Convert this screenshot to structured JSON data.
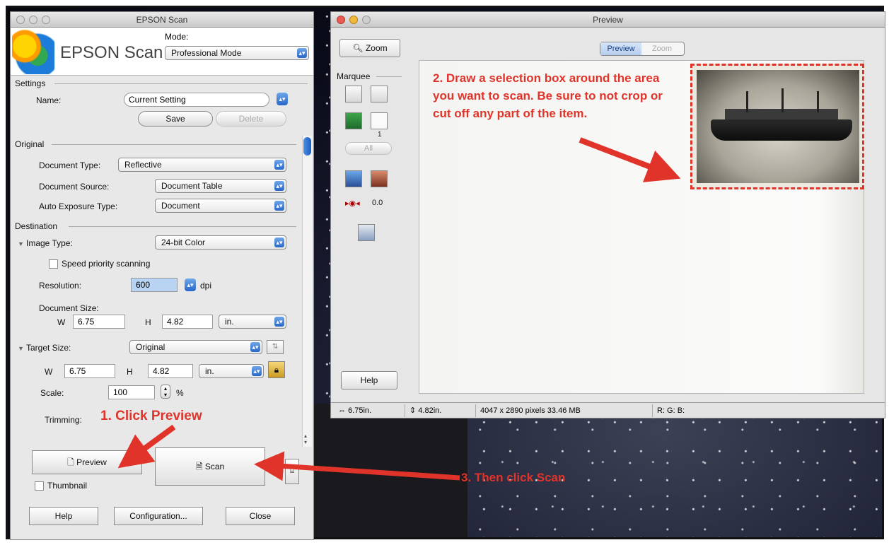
{
  "epson": {
    "title": "EPSON Scan",
    "brand": "EPSON Scan",
    "mode_label": "Mode:",
    "mode_value": "Professional Mode",
    "settings": {
      "heading": "Settings",
      "name_label": "Name:",
      "name_value": "Current Setting",
      "save": "Save",
      "delete": "Delete"
    },
    "original": {
      "heading": "Original",
      "doc_type_label": "Document Type:",
      "doc_type_value": "Reflective",
      "doc_source_label": "Document Source:",
      "doc_source_value": "Document Table",
      "auto_exp_label": "Auto Exposure Type:",
      "auto_exp_value": "Document"
    },
    "destination": {
      "heading": "Destination",
      "image_type_label": "Image Type:",
      "image_type_value": "24-bit Color",
      "speed_label": "Speed priority scanning",
      "resolution_label": "Resolution:",
      "resolution_value": "600",
      "dpi": "dpi",
      "doc_size_label": "Document Size:",
      "w_label": "W",
      "w_value": "6.75",
      "h_label": "H",
      "h_value": "4.82",
      "unit": "in."
    },
    "target": {
      "label": "Target Size:",
      "value": "Original",
      "w_label": "W",
      "w_value": "6.75",
      "h_label": "H",
      "h_value": "4.82",
      "unit": "in.",
      "scale_label": "Scale:",
      "scale_value": "100",
      "percent": "%",
      "trimming_label": "Trimming:"
    },
    "preview_button": "Preview",
    "scan_button": "Scan",
    "thumbnail_label": "Thumbnail",
    "help": "Help",
    "configuration": "Configuration...",
    "close": "Close"
  },
  "preview": {
    "title": "Preview",
    "zoom_button": "Zoom",
    "tabs": [
      "Preview",
      "Zoom"
    ],
    "marquee_label": "Marquee",
    "marquee_count": "1",
    "all_button": "All",
    "exposure_value": "0.0",
    "help": "Help",
    "status": {
      "width": "6.75in.",
      "height": "4.82in.",
      "pixels": "4047 x 2890 pixels 33.46 MB",
      "rgb": "R: G: B:"
    }
  },
  "annotations": {
    "step1": "1. Click Preview",
    "step2": "2. Draw a selection box around the area you want to scan. Be sure to not crop or cut off any part of the item.",
    "step3": "3. Then click Scan"
  },
  "colors": {
    "annotation": "#e0342a",
    "accent_blue": "#2767c9"
  }
}
